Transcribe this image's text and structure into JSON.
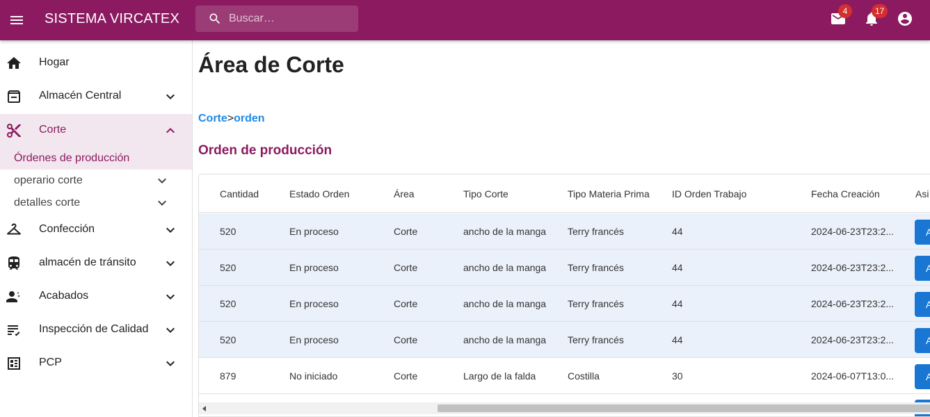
{
  "appbar": {
    "title": "SISTEMA VIRCATEX",
    "search_placeholder": "Buscar…",
    "mail_count": "4",
    "notification_count": "17",
    "color": "#8b1a60"
  },
  "sidebar": {
    "items": [
      {
        "label": "Hogar",
        "icon": "home-icon"
      },
      {
        "label": "Almacén Central",
        "icon": "archive-icon"
      },
      {
        "label": "Corte",
        "icon": "scissors-icon"
      },
      {
        "label": "Confección",
        "icon": "hanger-icon"
      },
      {
        "label": "almacén de tránsito",
        "icon": "train-icon"
      },
      {
        "label": "Acabados",
        "icon": "person-settings-icon"
      },
      {
        "label": "Inspección de Calidad",
        "icon": "checklist-icon"
      },
      {
        "label": "PCP",
        "icon": "dashboard-icon"
      }
    ],
    "subitems": [
      {
        "label": "Órdenes de producción"
      },
      {
        "label": "operario corte"
      },
      {
        "label": "detalles corte"
      }
    ]
  },
  "main": {
    "title": "Área de Corte",
    "breadcrumb": {
      "first": "Corte",
      "separator": ">",
      "second": "orden"
    },
    "section_title": "Orden de producción"
  },
  "table": {
    "columns": [
      "Cantidad",
      "Estado Orden",
      "Área",
      "Tipo Corte",
      "Tipo Materia Prima",
      "ID Orden Trabajo",
      "Fecha Creación",
      "Asi"
    ],
    "rows": [
      {
        "cantidad": "520",
        "estado": "En proceso",
        "area": "Corte",
        "tipo_corte": "ancho de la manga",
        "materia": "Terry francés",
        "id_orden": "44",
        "fecha": "2024-06-23T23:2...",
        "btn": "A"
      },
      {
        "cantidad": "520",
        "estado": "En proceso",
        "area": "Corte",
        "tipo_corte": "ancho de la manga",
        "materia": "Terry francés",
        "id_orden": "44",
        "fecha": "2024-06-23T23:2...",
        "btn": "A"
      },
      {
        "cantidad": "520",
        "estado": "En proceso",
        "area": "Corte",
        "tipo_corte": "ancho de la manga",
        "materia": "Terry francés",
        "id_orden": "44",
        "fecha": "2024-06-23T23:2...",
        "btn": "A"
      },
      {
        "cantidad": "520",
        "estado": "En proceso",
        "area": "Corte",
        "tipo_corte": "ancho de la manga",
        "materia": "Terry francés",
        "id_orden": "44",
        "fecha": "2024-06-23T23:2...",
        "btn": "A"
      },
      {
        "cantidad": "879",
        "estado": "No iniciado",
        "area": "Corte",
        "tipo_corte": "Largo de la falda",
        "materia": "Costilla",
        "id_orden": "30",
        "fecha": "2024-06-07T13:0...",
        "btn": "A"
      }
    ]
  }
}
